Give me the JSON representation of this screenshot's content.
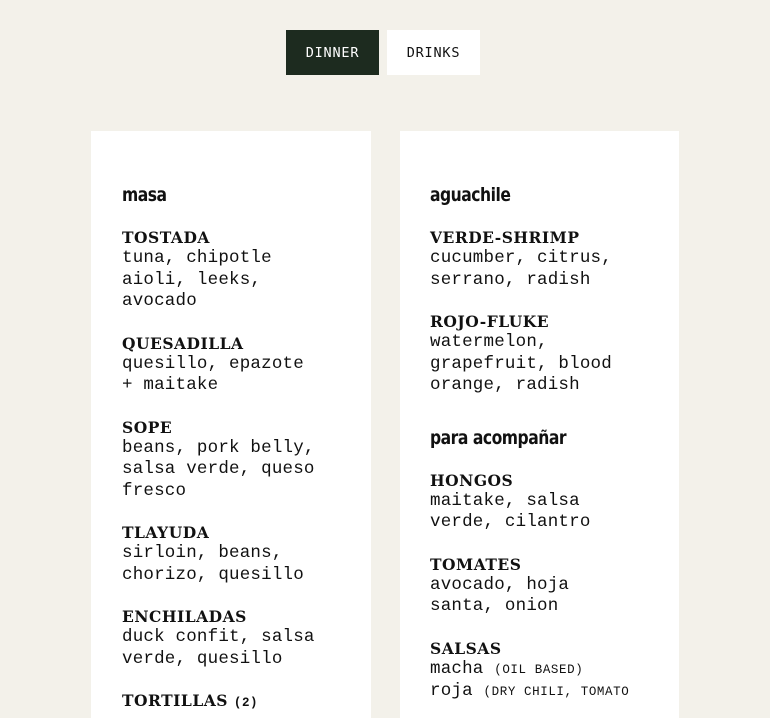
{
  "tabs": [
    {
      "label": "DINNER",
      "active": true
    },
    {
      "label": "DRINKS",
      "active": false
    }
  ],
  "colors": {
    "page_background": "#f3f1ea",
    "active_tab": "#1d2b1f",
    "card_background": "#ffffff"
  },
  "left": {
    "title": "masa",
    "items": [
      {
        "name": "TOSTADA",
        "desc_lines": [
          "tuna, chipotle",
          "aioli, leeks,",
          "avocado"
        ]
      },
      {
        "name": "QUESADILLA",
        "desc_lines": [
          "quesillo, epazote",
          "+ maitake"
        ]
      },
      {
        "name": "SOPE",
        "desc_lines": [
          "beans, pork belly,",
          "salsa verde, queso",
          "fresco"
        ]
      },
      {
        "name": "TLAYUDA",
        "desc_lines": [
          "sirloin, beans,",
          "chorizo, quesillo"
        ]
      },
      {
        "name": "ENCHILADAS",
        "desc_lines": [
          "duck confit, salsa",
          "verde, quesillo"
        ]
      },
      {
        "name": "TORTILLAS",
        "note": "(2)"
      }
    ]
  },
  "right": {
    "title": "aguachile",
    "items": [
      {
        "name": "VERDE-SHRIMP",
        "desc_lines": [
          "cucumber, citrus,",
          "serrano, radish"
        ]
      },
      {
        "name": "ROJO-FLUKE",
        "desc_lines": [
          "watermelon,",
          "grapefruit, blood",
          "orange, radish"
        ]
      }
    ],
    "title2": "para acompañar",
    "items2": [
      {
        "name": "HONGOS",
        "desc_lines": [
          "maitake, salsa",
          "verde, cilantro"
        ]
      },
      {
        "name": "TOMATES",
        "desc_lines": [
          "avocado, hoja",
          "santa, onion"
        ]
      },
      {
        "name": "SALSAS",
        "salsas": [
          {
            "name": "macha",
            "note": "(OIL BASED)"
          },
          {
            "name": "roja",
            "note": "(DRY CHILI, TOMATO"
          }
        ]
      }
    ]
  }
}
